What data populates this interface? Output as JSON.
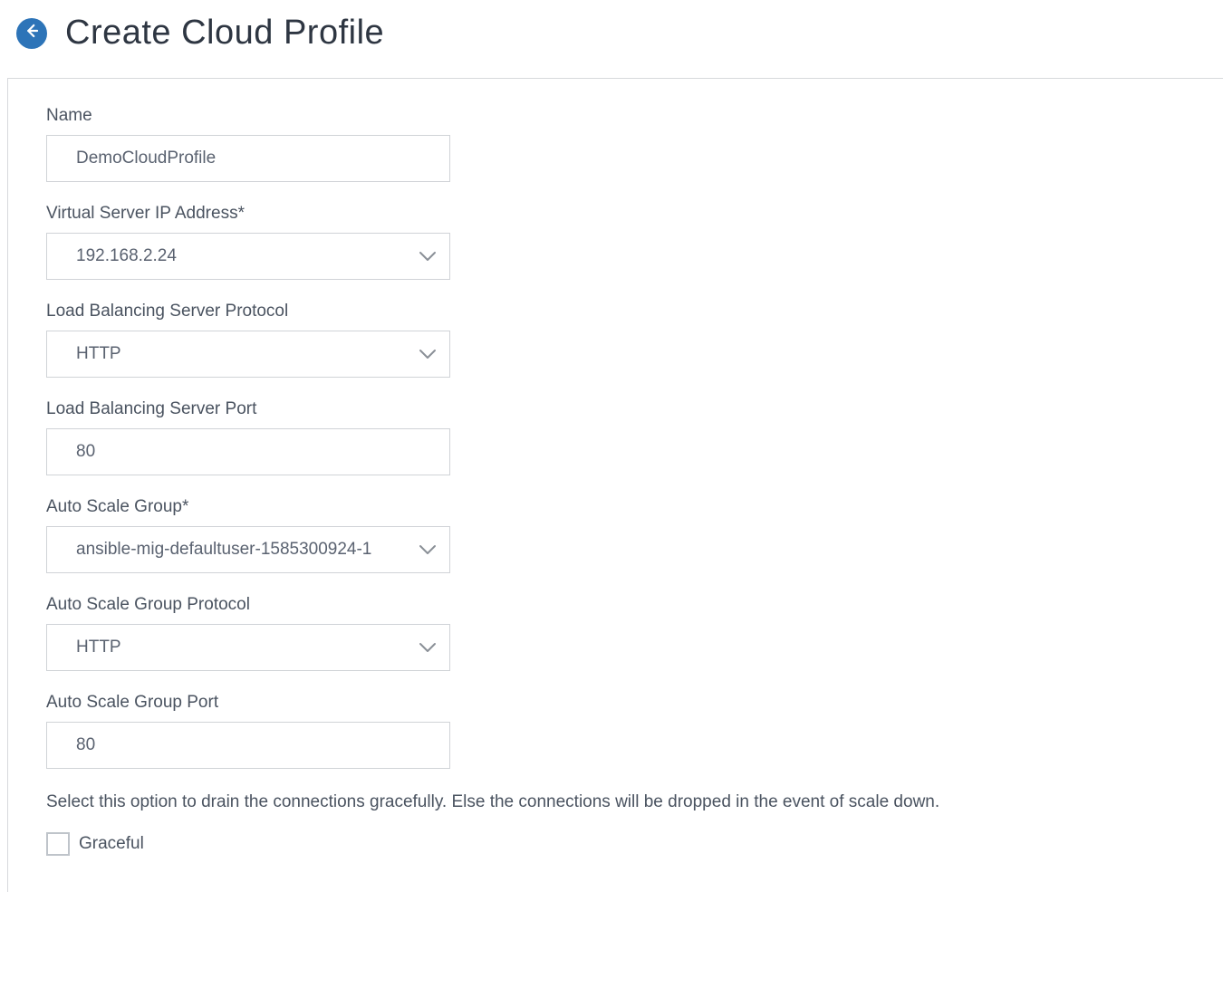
{
  "header": {
    "title": "Create Cloud Profile"
  },
  "fields": {
    "name": {
      "label": "Name",
      "value": "DemoCloudProfile"
    },
    "vip": {
      "label": "Virtual Server IP Address*",
      "value": "192.168.2.24"
    },
    "lb_protocol": {
      "label": "Load Balancing Server Protocol",
      "value": "HTTP"
    },
    "lb_port": {
      "label": "Load Balancing Server Port",
      "value": "80"
    },
    "asg": {
      "label": "Auto Scale Group*",
      "value": "ansible-mig-defaultuser-1585300924-1"
    },
    "asg_protocol": {
      "label": "Auto Scale Group Protocol",
      "value": "HTTP"
    },
    "asg_port": {
      "label": "Auto Scale Group Port",
      "value": "80"
    },
    "graceful": {
      "helper": "Select this option to drain the connections gracefully. Else the connections will be dropped in the event of scale down.",
      "label": "Graceful",
      "checked": false
    }
  }
}
